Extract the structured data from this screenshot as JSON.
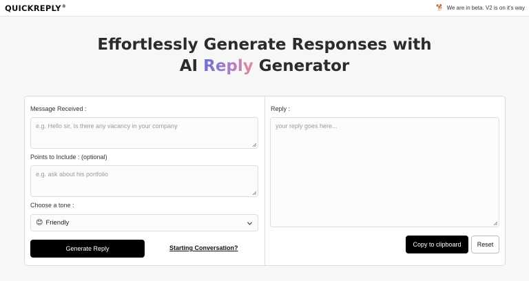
{
  "header": {
    "brand": "QUICKREPLY",
    "brand_mark": "®",
    "beta_icon": "dog-emoji-icon",
    "beta_text": "We are in beta. V2 is on it's way"
  },
  "hero": {
    "line1": "Effortlessly Generate Responses with",
    "line2_before": "AI ",
    "line2_highlight": "Reply",
    "line2_after": " Generator",
    "gradient_colors": [
      "#6c6fd6",
      "#a97bc7",
      "#e48c98"
    ]
  },
  "form": {
    "message_label": "Message Received :",
    "message_placeholder": "e.g. Hello sir, Is there any vacancy in your company",
    "points_label": "Points to Include : (optional)",
    "points_placeholder": "e.g. ask about his portfolio",
    "tone_label": "Choose a tone :",
    "tone_selected": "Friendly",
    "tone_icon": "smiling-face-icon",
    "generate_button": "Generate Reply",
    "starting_link": "Starting Conversation?"
  },
  "reply": {
    "label": "Reply :",
    "placeholder": "your reply goes here...",
    "copy_button": "Copy to clipboard",
    "reset_button": "Reset"
  }
}
